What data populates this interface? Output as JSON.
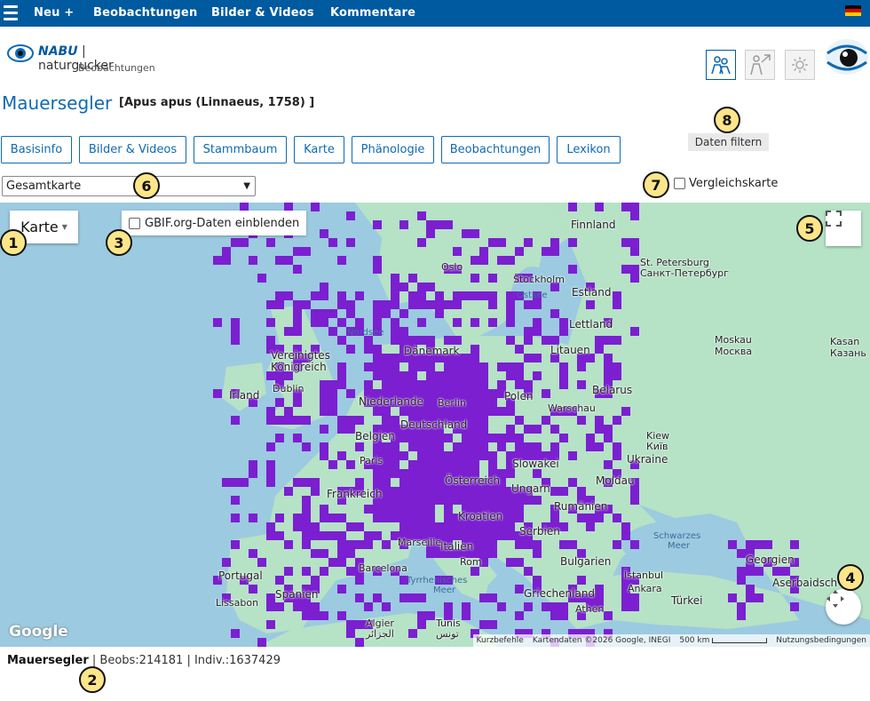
{
  "nav": {
    "items": [
      "Neu +",
      "Beobachtungen",
      "Bilder & Videos",
      "Kommentare"
    ],
    "color": "#005aa0"
  },
  "header": {
    "logo_brand": "NABU",
    "logo_name": "naturgucker",
    "logo_sub": "Beobachtungen"
  },
  "species": {
    "name": "Mauersegler",
    "scientific": "[Apus apus (Linnaeus, 1758) ]"
  },
  "tabs": [
    "Basisinfo",
    "Bilder & Videos",
    "Stammbaum",
    "Karte",
    "Phänologie",
    "Beobachtungen",
    "Lexikon"
  ],
  "filter_button": "Daten filtern",
  "map_select": {
    "value": "Gesamtkarte"
  },
  "compare": {
    "label": "Vergleichskarte"
  },
  "map": {
    "type_button": "Karte",
    "gbif_label": "GBIF.org-Daten einblenden",
    "google": "Google",
    "attribution": {
      "shortcuts": "Kurzbefehle",
      "data": "Kartendaten ©2026 Google, INEGI",
      "scale": "500 km",
      "terms": "Nutzungsbedingungen"
    },
    "labels": {
      "finnland": "Finnland",
      "stpete1": "St. Petersburg",
      "stpete2": "Санкт-Петербург",
      "stockholm": "Stockholm",
      "oslo": "Oslo",
      "ostsee": "Ostsee",
      "estland": "Estland",
      "lettland": "Lettland",
      "nordsee": "Nordsee",
      "moskau1": "Moskau",
      "moskau2": "Москва",
      "kasan1": "Kasan",
      "kasan2": "Казань",
      "litauen": "Litauen",
      "vk1": "Vereinigtes",
      "vk2": "Königreich",
      "daenemark": "Dänemark",
      "dublin": "Dublin",
      "irland": "Irland",
      "belarus": "Belarus",
      "polen": "Polen",
      "warschau": "Warschau",
      "niederlande": "Niederlande",
      "berlin": "Berlin",
      "deutschland": "Deutschland",
      "belgien": "Belgien",
      "kiew1": "Kiew",
      "kiew2": "Київ",
      "paris": "Paris",
      "ukraine": "Ukraine",
      "slowakei": "Slowakei",
      "frankreich": "Frankreich",
      "oesterreich": "Österreich",
      "moldau": "Moldau",
      "ungarn": "Ungarn",
      "kroatien": "Kroatien",
      "rumaenien": "Rumänien",
      "serbien": "Serbien",
      "italien": "Italien",
      "marseille": "Marseille",
      "schwarzes1": "Schwarzes",
      "schwarzes2": "Meer",
      "barcelona": "Barcelona",
      "rom": "Rom",
      "bulgarien": "Bulgarien",
      "portugal": "Portugal",
      "spanien": "Spanien",
      "tyrrh1": "Tyrrhenisches",
      "tyrrh2": "Meer",
      "istanbul": "İstanbul",
      "georgien": "Georgien",
      "aserb": "Aserbaidsch",
      "ankara": "Ankara",
      "griechenland": "Griechenland",
      "tuerkei": "Türkei",
      "lissabon": "Lissabon",
      "athen": "Athen",
      "algier1": "Algier",
      "algier2": "الجزائر",
      "tunis1": "Tunis",
      "tunis2": "تونس"
    }
  },
  "stats": {
    "species": "Mauersegler",
    "beobs": "| Beobs:214181",
    "indiv": "| Indiv.:1637429"
  },
  "callouts": [
    "1",
    "2",
    "3",
    "4",
    "5",
    "6",
    "7",
    "8"
  ],
  "colors": {
    "accent": "#0f6ab4",
    "occurrence": "#7b1fd1",
    "water": "#9ccae0",
    "land": "#b6e2c6",
    "callout": "#fde58a"
  }
}
